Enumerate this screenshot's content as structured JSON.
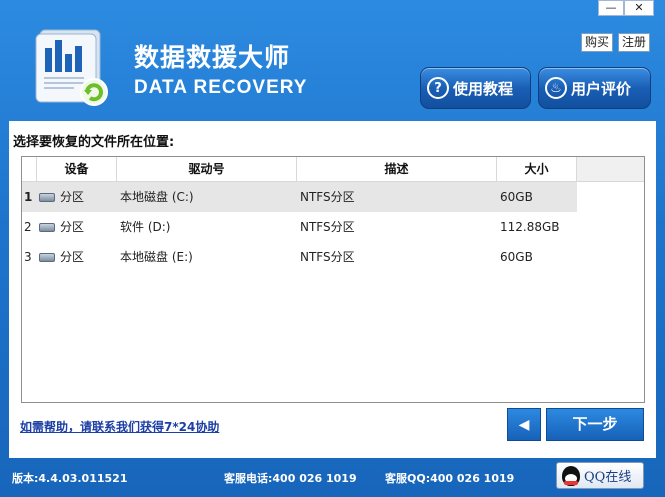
{
  "window": {
    "minimize_glyph": "—",
    "close_glyph": "✕"
  },
  "header": {
    "title_cn": "数据救援大师",
    "title_en": "DATA RECOVERY",
    "buy_label": "购买",
    "register_label": "注册",
    "tutorial_label": "使用教程",
    "tutorial_icon": "?",
    "review_label": "用户评价",
    "review_icon": "♨"
  },
  "main": {
    "prompt": "选择要恢复的文件所在位置:",
    "columns": [
      "设备",
      "驱动号",
      "描述",
      "大小"
    ],
    "rows": [
      {
        "num": "1",
        "device": "分区",
        "drive": "本地磁盘 (C:)",
        "desc": "NTFS分区",
        "size": "60GB"
      },
      {
        "num": "2",
        "device": "分区",
        "drive": "软件 (D:)",
        "desc": "NTFS分区",
        "size": "112.88GB"
      },
      {
        "num": "3",
        "device": "分区",
        "drive": "本地磁盘 (E:)",
        "desc": "NTFS分区",
        "size": "60GB"
      }
    ],
    "help_link": "如需帮助，请联系我们获得7*24协助",
    "back_glyph": "◀",
    "next_label": "下一步"
  },
  "footer": {
    "version": "版本:4.4.03.011521",
    "phone": "客服电话:400 026 1019",
    "qq": "客服QQ:400 026 1019",
    "qq_badge": "QQ在线"
  },
  "colors": {
    "accent": "#1e74cc",
    "selected_row": "#e6e6e6",
    "link": "#1c3fa6"
  }
}
